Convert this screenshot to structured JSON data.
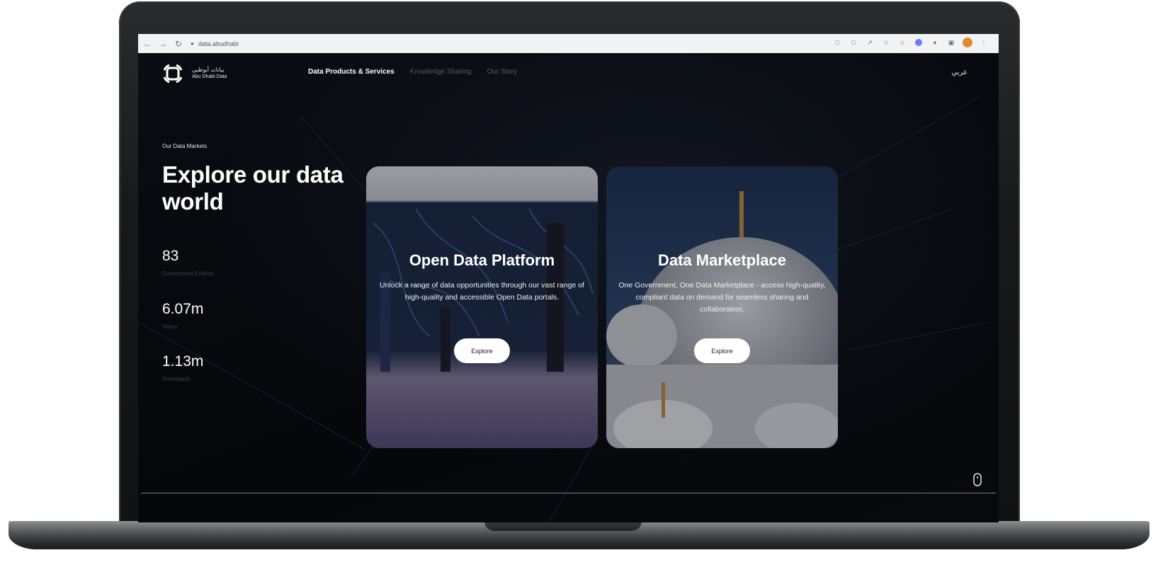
{
  "browser": {
    "url": "data.abudhabi"
  },
  "header": {
    "logo_arabic": "بيانات أبوظبي",
    "logo_english": "Abu Dhabi Data",
    "nav": [
      {
        "label": "Data Products & Services",
        "active": true
      },
      {
        "label": "Knowledge Sharing",
        "active": false
      },
      {
        "label": "Our Story",
        "active": false
      }
    ],
    "language_toggle": "عربي"
  },
  "hero": {
    "eyebrow": "Our Data Markets",
    "headline": "Explore our data world",
    "stats": [
      {
        "value": "83",
        "label": "Government Entities"
      },
      {
        "value": "6.07m",
        "label": "Views"
      },
      {
        "value": "1.13m",
        "label": "Downloads"
      }
    ]
  },
  "cards": [
    {
      "title": "Open Data Platform",
      "description": "Unlock a range of data opportunities through our vast range of high-quality and accessible Open Data portals.",
      "button": "Explore"
    },
    {
      "title": "Data Marketplace",
      "description": "One Government, One Data Marketplace - access high-quality, compliant data on demand for seamless sharing and collaboration.",
      "button": "Explore"
    }
  ],
  "icons": {
    "back": "back-arrow-icon",
    "forward": "forward-arrow-icon",
    "reload": "reload-icon",
    "site_info": "lock-icon",
    "scroll": "mouse-scroll-icon"
  }
}
